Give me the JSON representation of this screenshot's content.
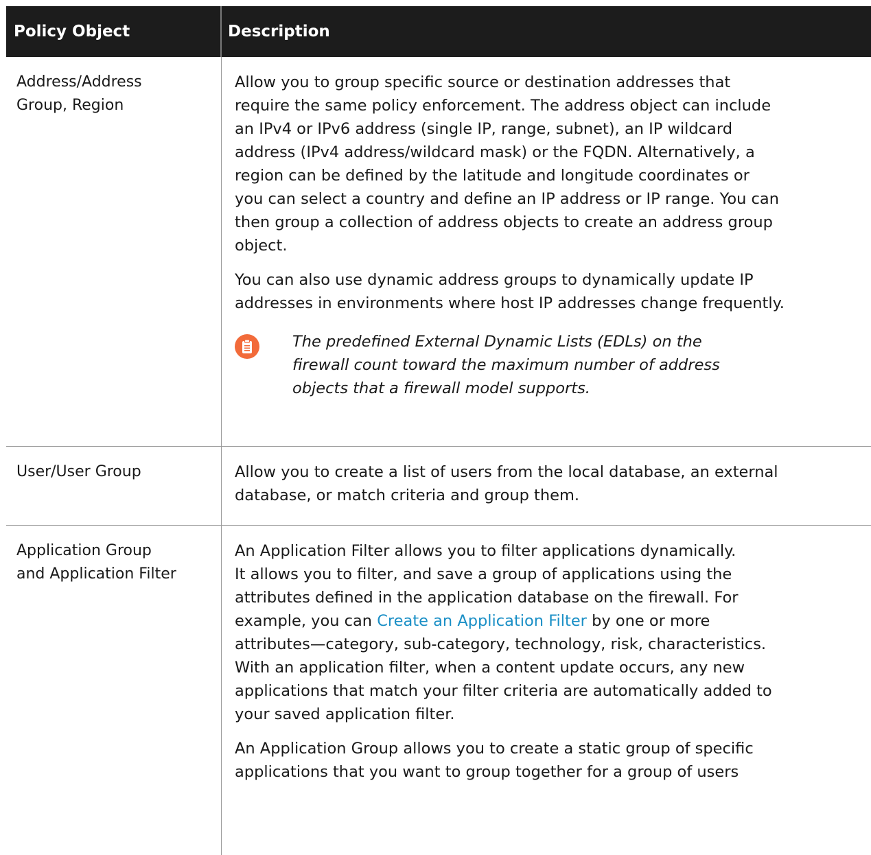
{
  "table": {
    "headers": {
      "col1": "Policy Object",
      "col2": "Description"
    },
    "rows": [
      {
        "object": "Address/Address\nGroup, Region",
        "paragraphs": [
          "Allow you to group specific source or destination addresses that\nrequire the same policy enforcement. The address object can include\nan IPv4 or IPv6 address (single IP, range, subnet), an IP wildcard\naddress (IPv4 address/wildcard mask) or the FQDN. Alternatively, a\nregion can be defined by the latitude and longitude coordinates or\nyou can select a country and define an IP address or IP range. You can\nthen group a collection of address objects to create an address group\nobject.",
          "You can also use dynamic address groups to dynamically update IP\naddresses in environments where host IP addresses change frequently."
        ],
        "note": "The predefined External Dynamic Lists (EDLs) on the\nfirewall count toward the maximum number of address\nobjects that a firewall model supports.",
        "note_icon": "clipboard-note-icon",
        "note_icon_color": "#f26b3a"
      },
      {
        "object": "User/User Group",
        "paragraphs": [
          "Allow you to create a list of users from the local database, an external\ndatabase, or match criteria and group them."
        ]
      },
      {
        "object": "Application Group\nand Application Filter",
        "para1_before_link": "An Application Filter allows you to filter applications dynamically.\nIt allows you to filter, and save a group of applications using the\nattributes defined in the application database on the firewall. For\nexample, you can ",
        "para1_link": "Create an Application Filter",
        "para1_after_link": " by one or more\nattributes—category, sub-category, technology, risk, characteristics.\nWith an application filter, when a content update occurs, any new\napplications that match your filter criteria are automatically added to\nyour saved application filter.",
        "para2": "An Application Group allows you to create a static group of specific\napplications that you want to group together for a group of users",
        "link_color": "#1a8fc6"
      }
    ]
  }
}
